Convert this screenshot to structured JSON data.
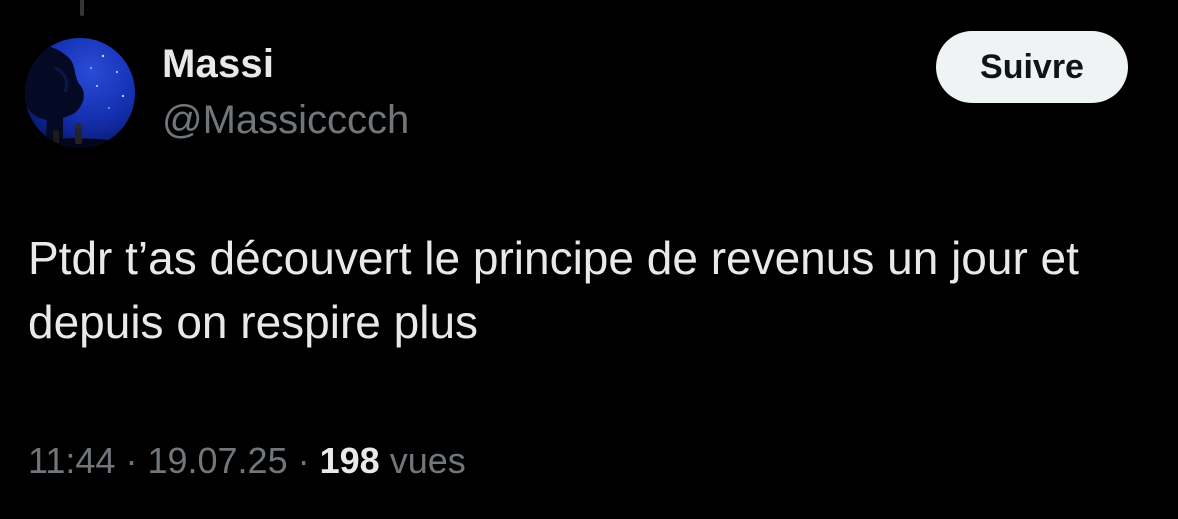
{
  "author": {
    "name": "Massi",
    "handle": "@Massicccch"
  },
  "follow_button": {
    "label": "Suivre"
  },
  "tweet": {
    "text": "Ptdr t’as découvert le principe de revenus un jour et depuis on respire plus"
  },
  "meta": {
    "time": "11:44",
    "separator": "·",
    "date": "19.07.25",
    "views_count": "198",
    "views_label": "vues"
  },
  "colors": {
    "background": "#000000",
    "primary_text": "#e7e9ea",
    "secondary_text": "#71767b",
    "button_bg": "#eff3f4",
    "avatar_bg": "#0a1a6e"
  },
  "icons": {
    "avatar": "profile-picture-night-sky"
  }
}
